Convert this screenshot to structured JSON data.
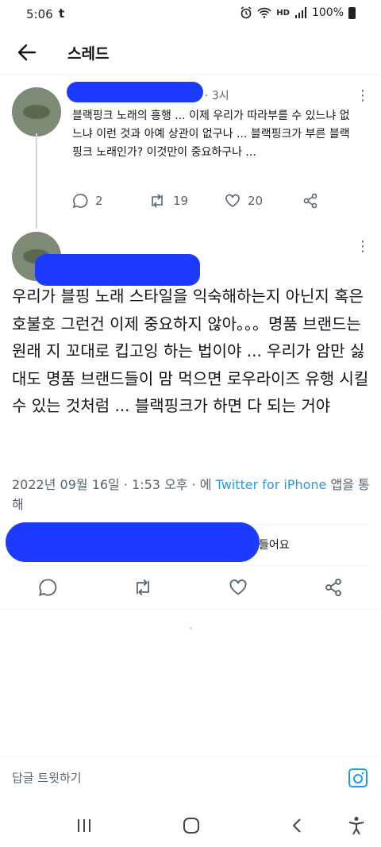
{
  "status_bar": {
    "time": "5:06",
    "carrier": "t",
    "battery": "100%",
    "network": "HD"
  },
  "header": {
    "title": "스레드",
    "back_icon": "arrow-left-icon"
  },
  "reply_tweet": {
    "time": "· 3시",
    "text": "블랙핑크 노래의 흥행 ... 이제 우리가 따라부를 수 있느냐 없느냐 이런 것과 아예 상관이 없구나 ... 블랙핑크가 부른 블랙핑크 노래인가? 이것만이 중요하구나 ...",
    "replies": "2",
    "retweets": "19",
    "likes": "20"
  },
  "main_tweet": {
    "text": "우리가 블핑 노래 스타일을 익숙해하는지 아닌지 혹은 호불호 그런건 이제 중요하지 않아。。。명품 브랜드는 원래 지 꼬대로 킵고잉 하는 법이야 ... 우리가 암만 싫대도 명품 브랜드들이 맘 먹으면 로우라이즈 유행 시킬 수 있는 것처럼 ... 블랙핑크가 하면 다 되는 거야",
    "date": "2022년 09월 16일",
    "time": "· 1:53 오후 · 에",
    "source": "Twitter for iPhone",
    "source_suffix": "앱을 통해",
    "likes_suffix": "들어요"
  },
  "reply_bar": {
    "placeholder": "답글 트윗하기",
    "camera_icon": "camera-icon"
  },
  "nav": {
    "icons": [
      "recent-apps-icon",
      "home-icon",
      "back-icon",
      "accessibility-icon"
    ]
  },
  "colors": {
    "accent": "#1d9bf0",
    "redaction": "#1d3bff",
    "muted": "#536471"
  }
}
